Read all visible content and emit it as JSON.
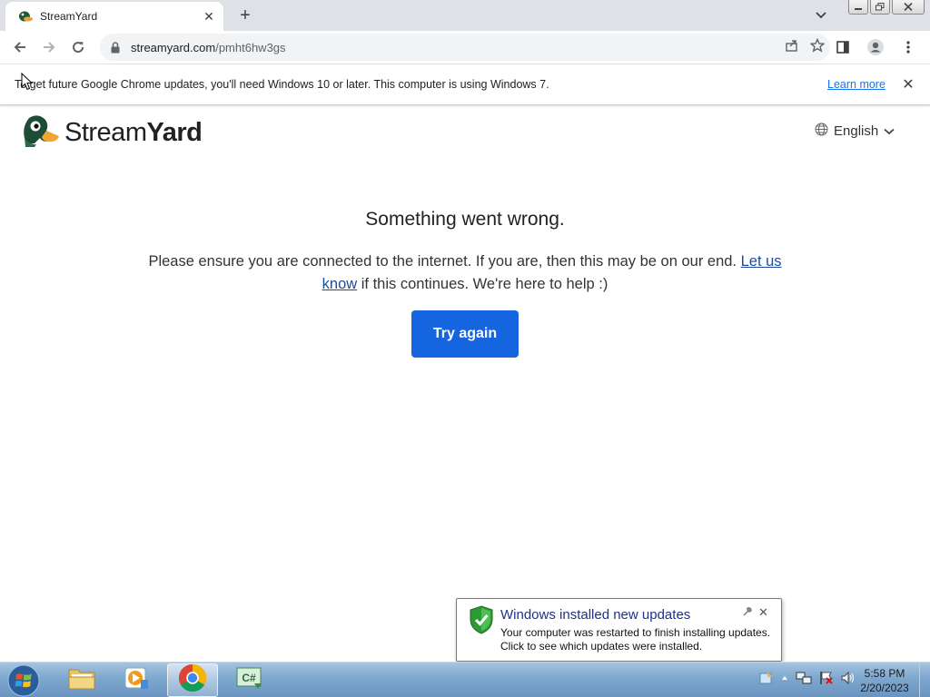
{
  "browser": {
    "tab": {
      "title": "StreamYard",
      "favicon": "streamyard-duck-icon"
    },
    "new_tab_label": "+",
    "url_host": "streamyard.com",
    "url_path": "/pmht6hw3gs",
    "infobar": {
      "text": "To get future Google Chrome updates, you'll need Windows 10 or later. This computer is using Windows 7.",
      "link": "Learn more"
    }
  },
  "page": {
    "logo": {
      "regular": "Stream",
      "bold": "Yard"
    },
    "language": "English",
    "heading": "Something went wrong.",
    "message_before": "Please ensure you are connected to the internet. If you are, then this may be on our end.",
    "message_link": "Let us know",
    "message_after": "if this continues. We're here to help :)",
    "button": "Try again",
    "accent_color": "#1565e0"
  },
  "notification": {
    "title": "Windows installed new updates",
    "line1": "Your computer was restarted to finish installing updates.",
    "line2": "Click to see which updates were installed."
  },
  "taskbar": {
    "items": [
      "windows-explorer",
      "media-player",
      "google-chrome",
      "csharp-editor"
    ],
    "time": "5:58 PM",
    "date": "2/20/2023"
  }
}
